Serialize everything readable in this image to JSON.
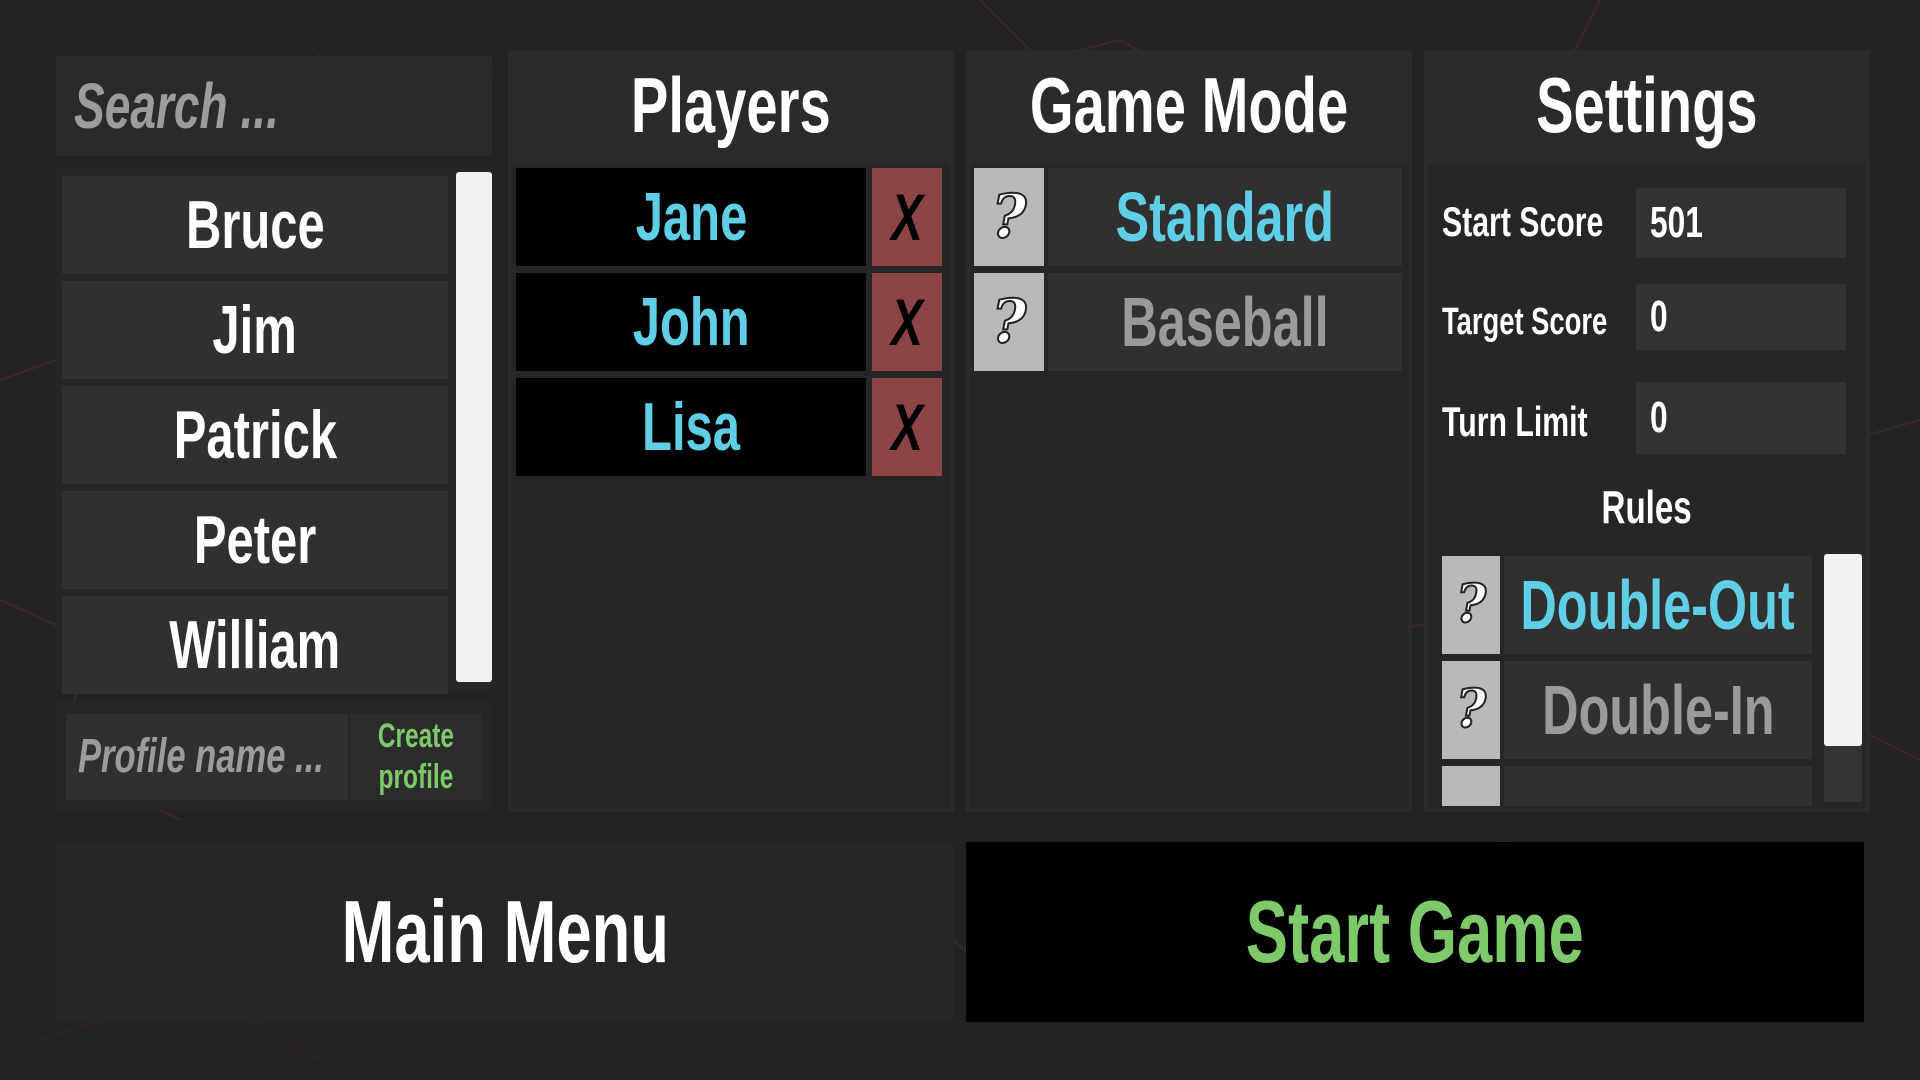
{
  "colors": {
    "accent_cyan": "#5ecfe6",
    "accent_green": "#7ec96a",
    "inactive_gray": "#9a9a9a",
    "remove_red": "#8c4444"
  },
  "search": {
    "placeholder": "Search ..."
  },
  "profiles": [
    {
      "name": "Bruce"
    },
    {
      "name": "Jim"
    },
    {
      "name": "Patrick"
    },
    {
      "name": "Peter"
    },
    {
      "name": "William"
    }
  ],
  "create_profile": {
    "placeholder": "Profile name ...",
    "button_line1": "Create",
    "button_line2": "profile"
  },
  "players_panel": {
    "title": "Players",
    "remove_label": "X",
    "players": [
      {
        "name": "Jane"
      },
      {
        "name": "John"
      },
      {
        "name": "Lisa"
      }
    ]
  },
  "game_mode_panel": {
    "title": "Game Mode",
    "help_label": "?",
    "modes": [
      {
        "name": "Standard",
        "selected": true
      },
      {
        "name": "Baseball",
        "selected": false
      }
    ]
  },
  "settings_panel": {
    "title": "Settings",
    "start_score_label": "Start Score",
    "start_score_value": "501",
    "target_score_label": "Target Score",
    "target_score_value": "0",
    "turn_limit_label": "Turn Limit",
    "turn_limit_value": "0",
    "rules_title": "Rules",
    "rules": [
      {
        "name": "Double-Out",
        "selected": true
      },
      {
        "name": "Double-In",
        "selected": false
      }
    ]
  },
  "bottom": {
    "main_menu_label": "Main Menu",
    "start_game_label": "Start Game"
  }
}
